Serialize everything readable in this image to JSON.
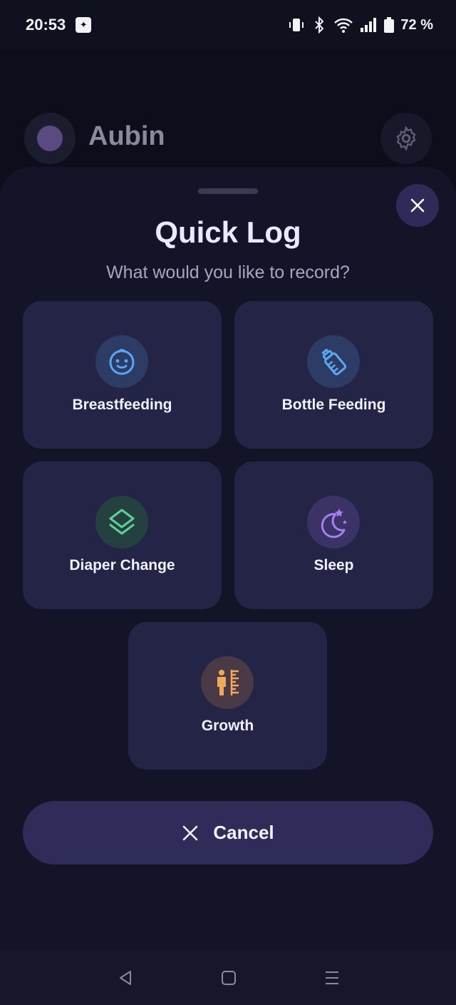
{
  "status_bar": {
    "time": "20:53",
    "battery": "72 %",
    "icons": [
      "vibrate-icon",
      "bluetooth-icon",
      "wifi-icon",
      "signal-icon",
      "battery-icon"
    ]
  },
  "app": {
    "child_name": "Aubin"
  },
  "quick_log": {
    "title": "Quick Log",
    "subtitle": "What would you like to record?",
    "options": [
      {
        "label": "Breastfeeding",
        "icon": "baby-face-icon",
        "color": "#5aa7f2"
      },
      {
        "label": "Bottle Feeding",
        "icon": "bottle-icon",
        "color": "#5aa7f2"
      },
      {
        "label": "Diaper Change",
        "icon": "layers-icon",
        "color": "#5fcf9a"
      },
      {
        "label": "Sleep",
        "icon": "moon-stars-icon",
        "color": "#a57ff0"
      },
      {
        "label": "Growth",
        "icon": "height-ruler-icon",
        "color": "#f0a85a"
      }
    ],
    "cancel_label": "Cancel"
  },
  "colors": {
    "accent": "#302c5a",
    "tile": "#232446",
    "sheet": "#131427"
  }
}
